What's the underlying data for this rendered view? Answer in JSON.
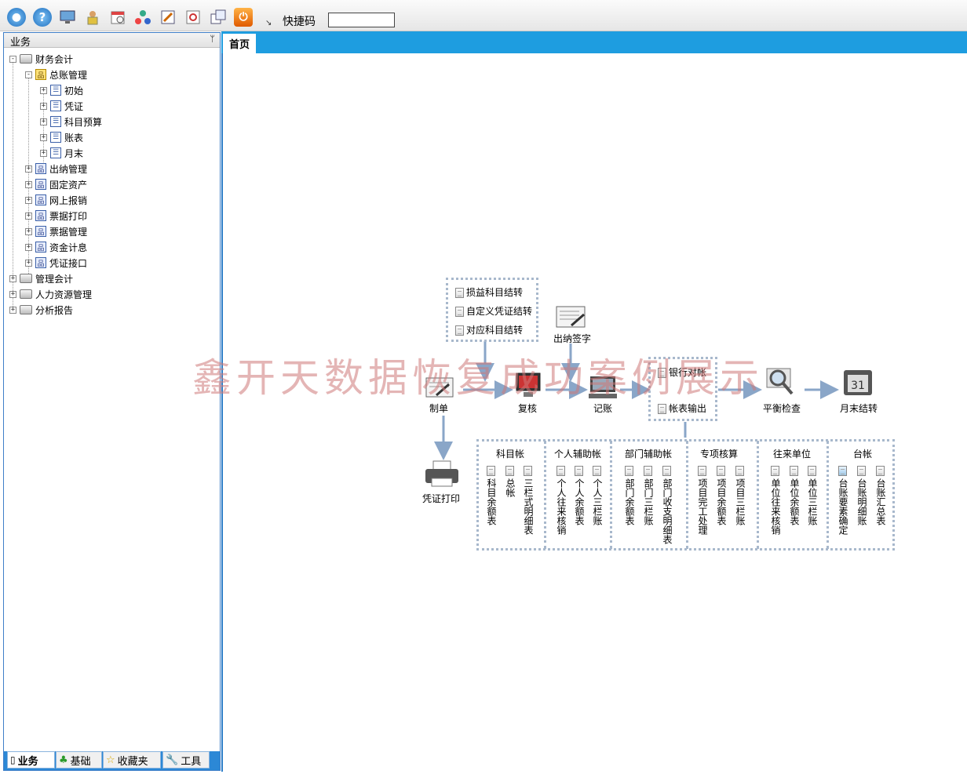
{
  "toolbar": {
    "icons": [
      "user-icon",
      "help-icon",
      "monitor-icon",
      "lock-user-icon",
      "calendar-icon",
      "network-icon",
      "tool-window-icon",
      "restore-icon",
      "windows-icon",
      "power-icon"
    ],
    "shortcut_label": "快捷码",
    "shortcut_value": ""
  },
  "left_panel": {
    "title": "业务",
    "pin": "ᛘ",
    "tree": [
      {
        "label": "财务会计",
        "expander": "-"
      },
      {
        "label": "总账管理",
        "expander": "-"
      },
      {
        "label": "初始",
        "expander": "+"
      },
      {
        "label": "凭证",
        "expander": "+"
      },
      {
        "label": "科目预算",
        "expander": "+"
      },
      {
        "label": "账表",
        "expander": "+"
      },
      {
        "label": "月末",
        "expander": "+"
      },
      {
        "label": "出纳管理",
        "expander": "+"
      },
      {
        "label": "固定资产",
        "expander": "+"
      },
      {
        "label": "网上报销",
        "expander": "+"
      },
      {
        "label": "票据打印",
        "expander": "+"
      },
      {
        "label": "票据管理",
        "expander": "+"
      },
      {
        "label": "资金计息",
        "expander": "+"
      },
      {
        "label": "凭证接口",
        "expander": "+"
      },
      {
        "label": "管理会计",
        "expander": "+"
      },
      {
        "label": "人力资源管理",
        "expander": "+"
      },
      {
        "label": "分析报告",
        "expander": "+"
      }
    ],
    "bottom_tabs": [
      "业务",
      "基础",
      "收藏夹",
      "工具"
    ]
  },
  "main": {
    "tab": "首页",
    "watermark": "鑫开天数据恢复成功案例展示",
    "transfer_box": [
      "损益科目结转",
      "自定义凭证结转",
      "对应科目结转"
    ],
    "flow": {
      "cashier_sign": "出纳签字",
      "make": "制单",
      "review": "复核",
      "post": "记账",
      "bank_reconcile": "银行对帐",
      "report_output": "帐表输出",
      "balance_check": "平衡检查",
      "month_end": "月末结转",
      "voucher_print": "凭证打印"
    },
    "ledgers": [
      {
        "title": "科目帐",
        "items": [
          "科目余额表",
          "总帐",
          "三栏式明细表"
        ]
      },
      {
        "title": "个人辅助帐",
        "items": [
          "个人往来核销",
          "个人余额表",
          "个人三栏账"
        ]
      },
      {
        "title": "部门辅助帐",
        "items": [
          "部门余额表",
          "部门三栏账",
          "部门收支明细表"
        ]
      },
      {
        "title": "专项核算",
        "items": [
          "项目完工处理",
          "项目余额表",
          "项目三栏账"
        ]
      },
      {
        "title": "往来单位",
        "items": [
          "单位往来核销",
          "单位余额表",
          "单位三栏账"
        ]
      },
      {
        "title": "台帐",
        "items": [
          "台账要素确定",
          "台账明细账",
          "台账汇总表"
        ]
      }
    ]
  }
}
